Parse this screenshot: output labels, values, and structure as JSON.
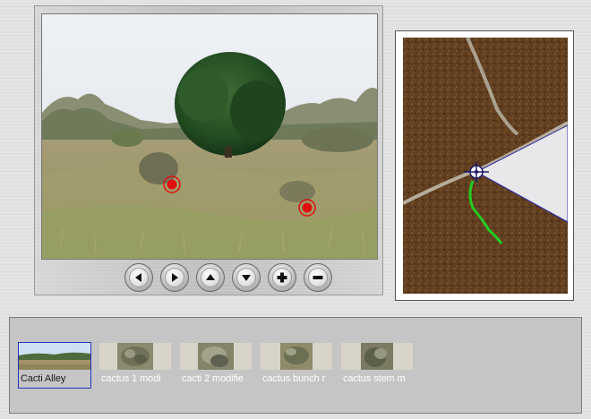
{
  "viewer": {
    "hotspots": [
      {
        "name": "hotspot-1"
      },
      {
        "name": "hotspot-2"
      }
    ]
  },
  "navigation": [
    {
      "name": "nav-left-button",
      "icon": "arrow-left-icon"
    },
    {
      "name": "nav-right-button",
      "icon": "arrow-right-icon"
    },
    {
      "name": "nav-up-button",
      "icon": "arrow-up-icon"
    },
    {
      "name": "nav-down-button",
      "icon": "arrow-down-icon"
    },
    {
      "name": "zoom-in-button",
      "icon": "plus-icon"
    },
    {
      "name": "zoom-out-button",
      "icon": "minus-icon"
    }
  ],
  "map": {
    "marker_icon": "crosshair-icon",
    "track_color": "#22cc22",
    "view_cone_color": "#e8e8ea"
  },
  "thumbnails": [
    {
      "label": "Cacti Alley",
      "selected": true
    },
    {
      "label": "cactus 1 modi",
      "selected": false
    },
    {
      "label": "cacti 2 modifie",
      "selected": false
    },
    {
      "label": "cactus bunch r",
      "selected": false
    },
    {
      "label": "cactus stem m",
      "selected": false
    }
  ],
  "colors": {
    "hotspot_red": "#e01010",
    "selection_outline": "#2233bb"
  }
}
